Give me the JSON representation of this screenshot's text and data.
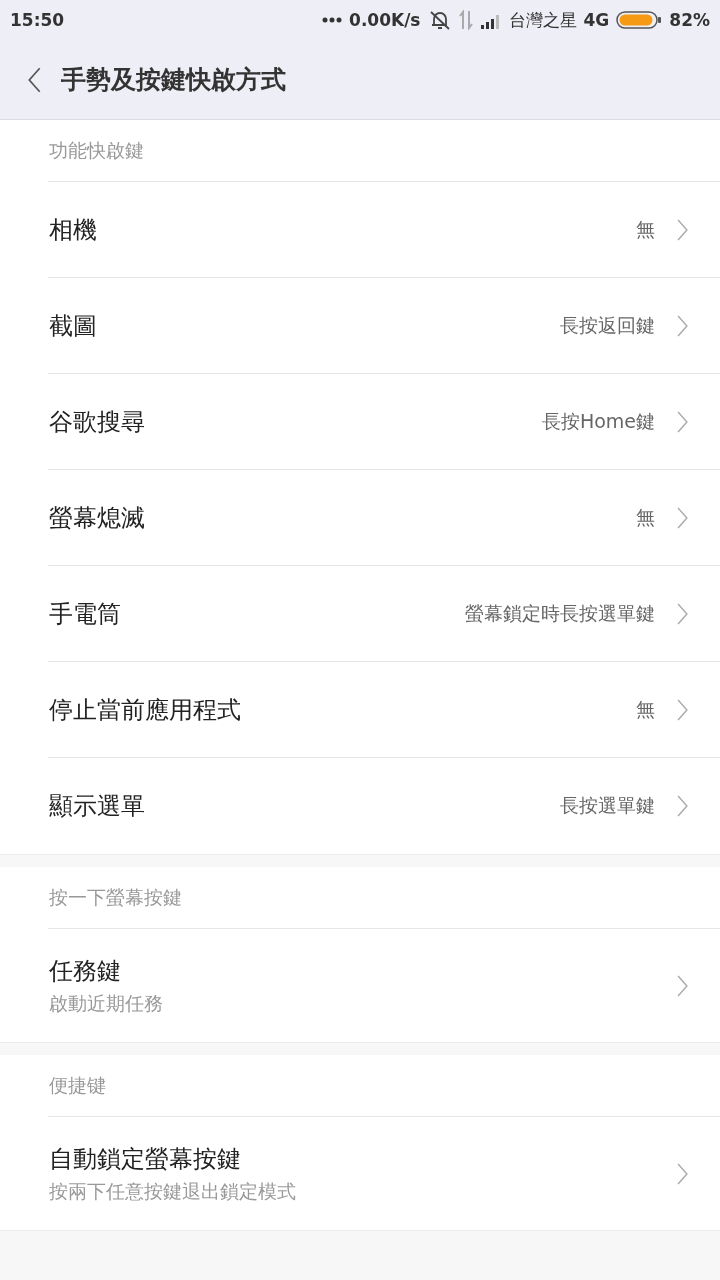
{
  "status_bar": {
    "time": "15:50",
    "speed": "0.00K/s",
    "carrier": "台灣之星",
    "network": "4G",
    "battery": "82%"
  },
  "header": {
    "title": "手勢及按鍵快啟方式"
  },
  "sections": [
    {
      "title": "功能快啟鍵",
      "items": [
        {
          "label": "相機",
          "value": "無"
        },
        {
          "label": "截圖",
          "value": "長按返回鍵"
        },
        {
          "label": "谷歌搜尋",
          "value": "長按Home鍵"
        },
        {
          "label": "螢幕熄滅",
          "value": "無"
        },
        {
          "label": "手電筒",
          "value": "螢幕鎖定時長按選單鍵"
        },
        {
          "label": "停止當前應用程式",
          "value": "無"
        },
        {
          "label": "顯示選單",
          "value": "長按選單鍵"
        }
      ]
    },
    {
      "title": "按一下螢幕按鍵",
      "items": [
        {
          "label": "任務鍵",
          "subtitle": "啟動近期任務"
        }
      ]
    },
    {
      "title": "便捷键",
      "items": [
        {
          "label": "自動鎖定螢幕按鍵",
          "subtitle": "按兩下任意按鍵退出鎖定模式"
        }
      ]
    }
  ]
}
